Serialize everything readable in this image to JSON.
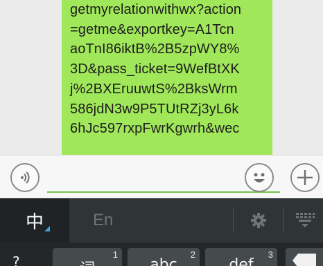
{
  "chat": {
    "message_text": "getmyrelationwithwx?action\n=getme&exportkey=A1Tcn\naoTnI86iktB%2B5zpWY8%\n3D&pass_ticket=9WefBtXK\nj%2BXEruuwtS%2BksWrm\n586jdN3w9P5TUtRZj3yL6k\n6hJc597rxpFwrKgwrh&wec",
    "bubble_color": "#a0e75a"
  },
  "input_bar": {
    "voice_icon": "voice-icon",
    "emoji_icon": "emoji-icon",
    "plus_icon": "plus-icon",
    "input_value": "",
    "accent_color": "#74c34a"
  },
  "keyboard": {
    "lang_chinese": "中",
    "lang_english": "En",
    "settings_icon": "gear-icon",
    "hide_icon": "keyboard-hide-icon",
    "symbol_key": "?",
    "keys": [
      {
        "number": "1",
        "label": "词"
      },
      {
        "number": "2",
        "label": "abc"
      },
      {
        "number": "3",
        "label": "def"
      }
    ]
  }
}
